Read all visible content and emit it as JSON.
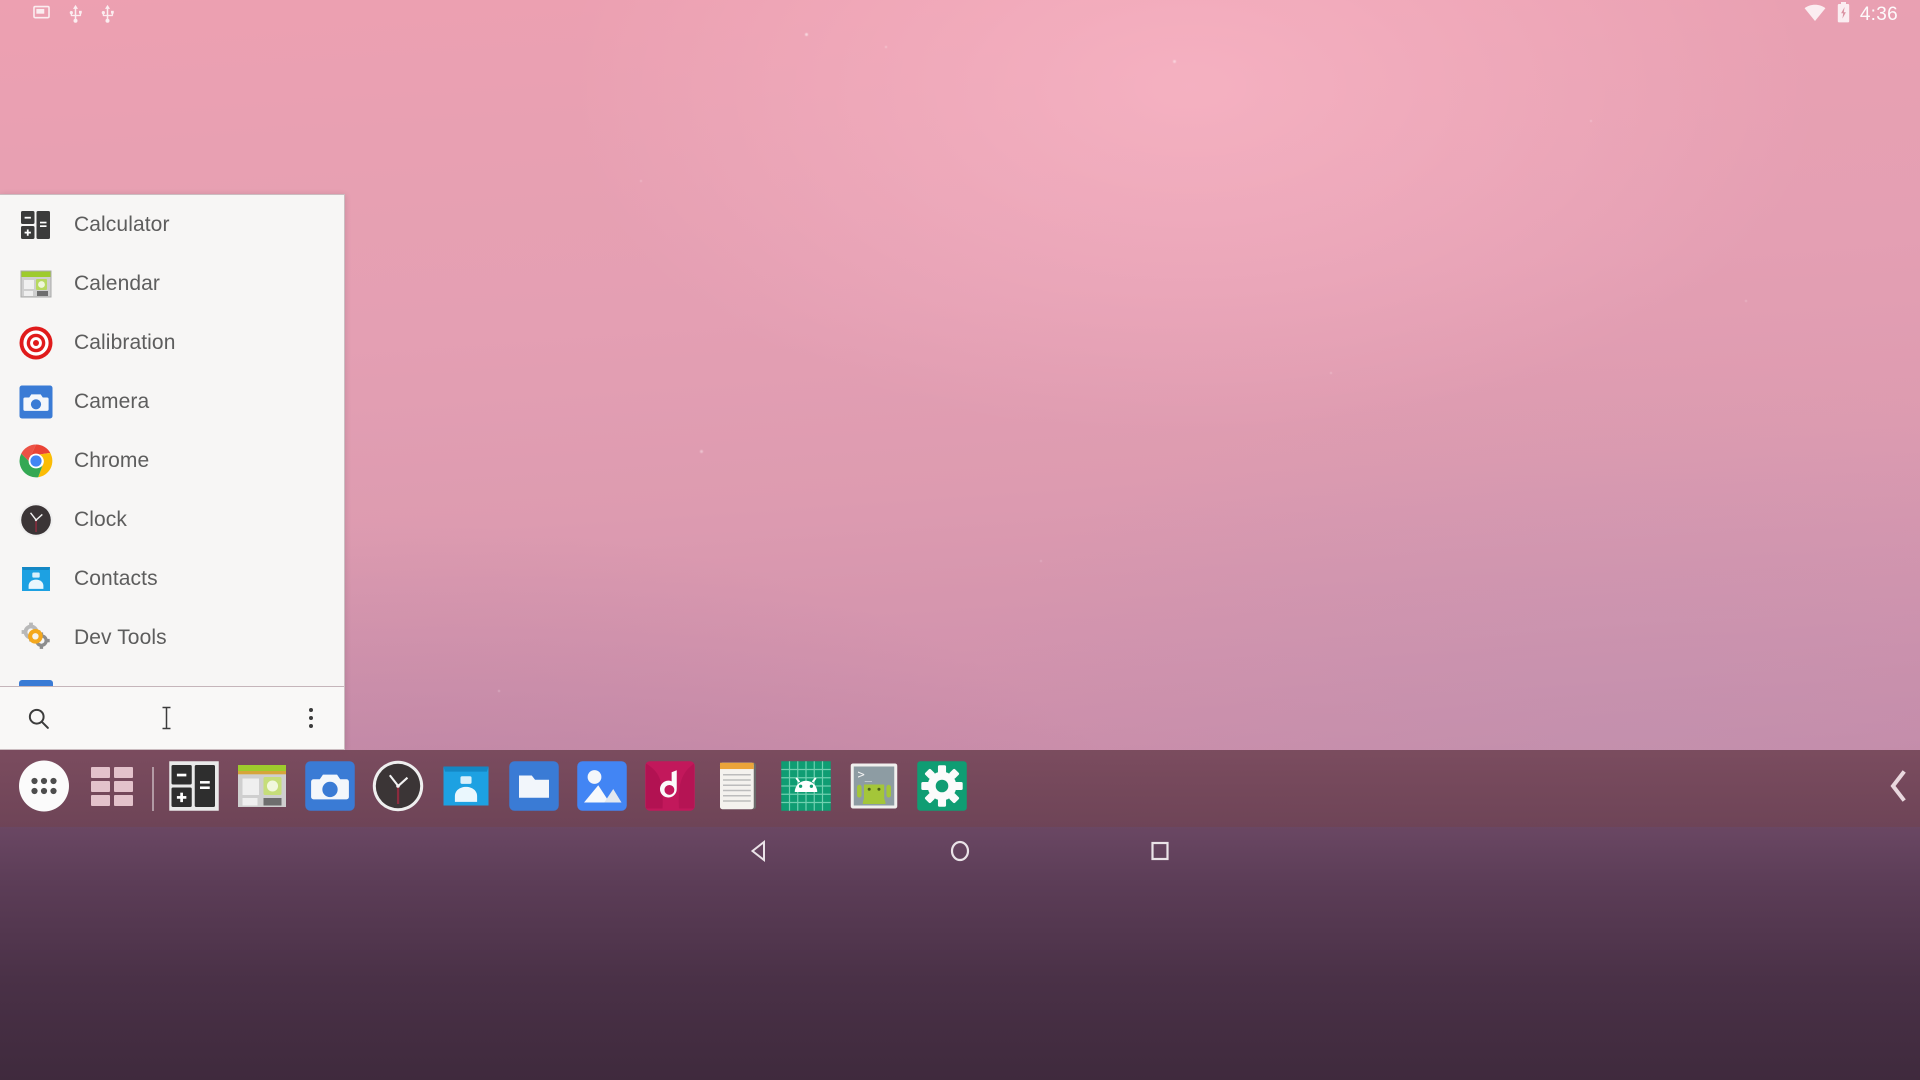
{
  "status_bar": {
    "left_icons": [
      {
        "name": "screen-cast-icon",
        "glyph": "screen"
      },
      {
        "name": "usb-icon-1",
        "glyph": "usb"
      },
      {
        "name": "usb-icon-2",
        "glyph": "usb"
      }
    ],
    "wifi_icon": "wifi-icon",
    "battery_icon": "battery-charging-icon",
    "time": "4:36"
  },
  "app_list": {
    "apps": [
      {
        "label": "Calculator",
        "icon": "calculator-icon"
      },
      {
        "label": "Calendar",
        "icon": "calendar-icon"
      },
      {
        "label": "Calibration",
        "icon": "calibration-target-icon"
      },
      {
        "label": "Camera",
        "icon": "camera-icon"
      },
      {
        "label": "Chrome",
        "icon": "chrome-icon"
      },
      {
        "label": "Clock",
        "icon": "clock-icon"
      },
      {
        "label": "Contacts",
        "icon": "contacts-icon"
      },
      {
        "label": "Dev Tools",
        "icon": "dev-tools-gear-icon"
      },
      {
        "label": "",
        "icon": "partial-blue-app-icon"
      }
    ],
    "search": {
      "placeholder": "",
      "value": "",
      "search_icon": "search-icon",
      "overflow_icon": "overflow-menu-icon"
    }
  },
  "taskbar": {
    "items": [
      {
        "name": "all-apps-button",
        "icon": "app-drawer-dots-icon"
      },
      {
        "name": "recent-apps-grid-button",
        "icon": "grid-squares-icon"
      },
      {
        "name": "divider",
        "icon": "divider"
      },
      {
        "name": "taskbar-app-calculator",
        "icon": "calculator-icon"
      },
      {
        "name": "taskbar-app-calendar",
        "icon": "calendar-icon"
      },
      {
        "name": "taskbar-app-camera",
        "icon": "camera-icon"
      },
      {
        "name": "taskbar-app-clock",
        "icon": "clock-icon"
      },
      {
        "name": "taskbar-app-contacts",
        "icon": "contacts-icon"
      },
      {
        "name": "taskbar-app-files",
        "icon": "files-folder-icon"
      },
      {
        "name": "taskbar-app-photos",
        "icon": "photos-gallery-icon"
      },
      {
        "name": "taskbar-app-music",
        "icon": "music-note-icon"
      },
      {
        "name": "taskbar-app-notes",
        "icon": "notepad-icon"
      },
      {
        "name": "taskbar-app-android-grid",
        "icon": "android-grid-icon"
      },
      {
        "name": "taskbar-app-terminal",
        "icon": "android-terminal-icon"
      },
      {
        "name": "taskbar-app-settings",
        "icon": "settings-gear-icon"
      }
    ],
    "collapse_icon": "chevron-left-icon"
  },
  "nav_bar": {
    "buttons": [
      {
        "name": "back-button",
        "icon": "back-triangle-icon"
      },
      {
        "name": "home-button",
        "icon": "home-circle-icon"
      },
      {
        "name": "recents-button",
        "icon": "recents-square-icon"
      }
    ]
  },
  "colors": {
    "panel_bg": "#f7f6f5",
    "taskbar_bg": "#754759",
    "navbar_bg": "#4a3147",
    "label_text": "#5d5d5d",
    "accent_red": "#e01b1b",
    "wallpaper_top": "#eda0b1",
    "wallpaper_bottom": "#6b4a66"
  }
}
